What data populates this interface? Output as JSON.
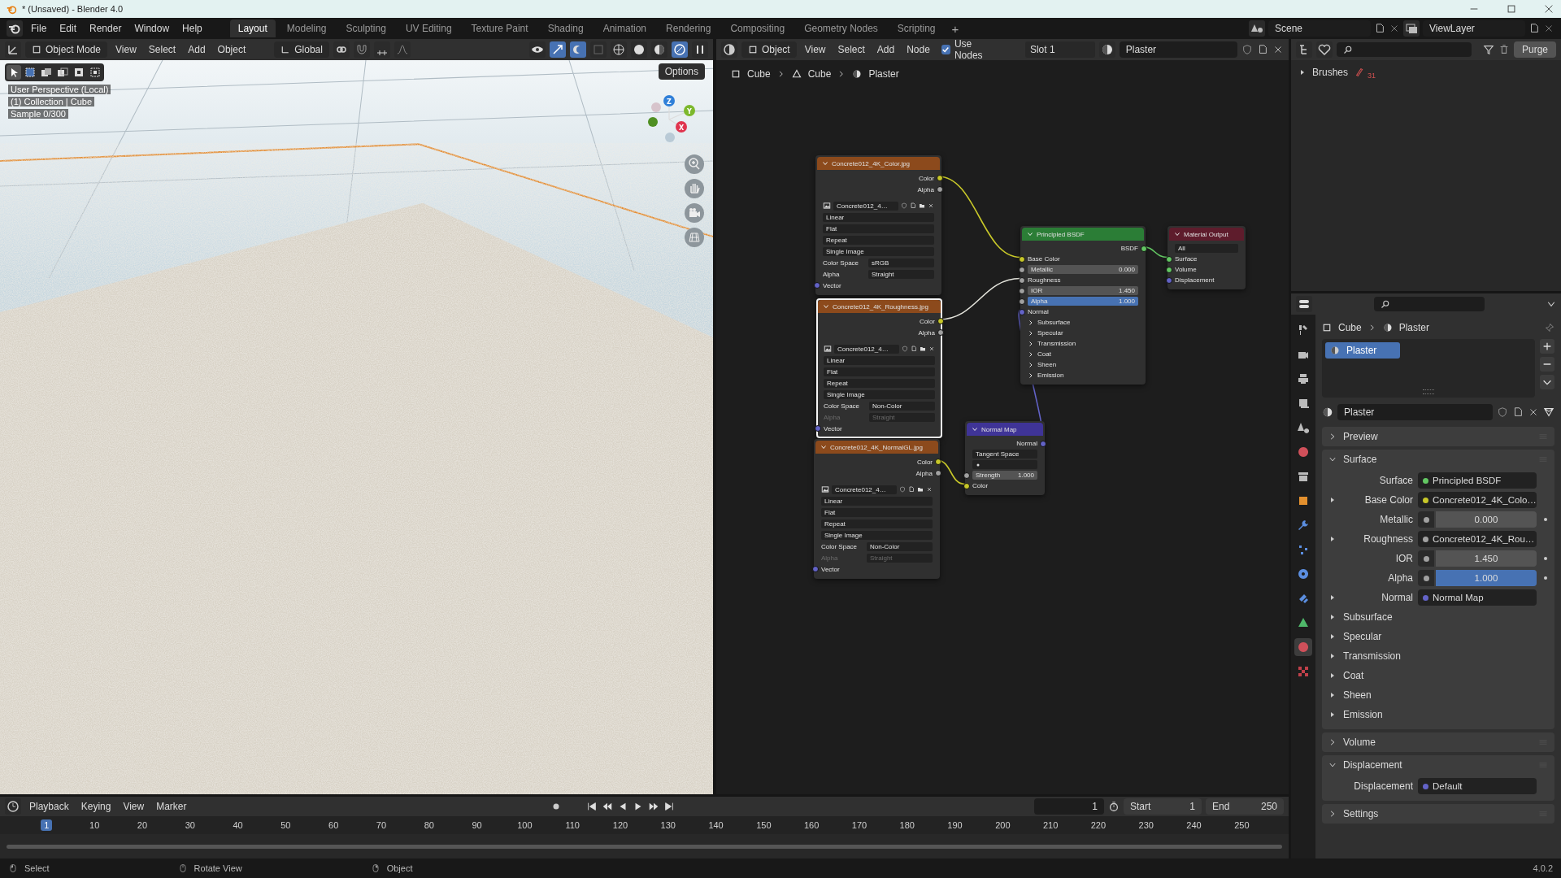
{
  "window": {
    "title": "* (Unsaved) - Blender 4.0"
  },
  "menu": [
    "File",
    "Edit",
    "Render",
    "Window",
    "Help"
  ],
  "workspaces": [
    {
      "label": "Layout",
      "selected": true
    },
    {
      "label": "Modeling",
      "selected": false
    },
    {
      "label": "Sculpting",
      "selected": false
    },
    {
      "label": "UV Editing",
      "selected": false
    },
    {
      "label": "Texture Paint",
      "selected": false
    },
    {
      "label": "Shading",
      "selected": false
    },
    {
      "label": "Animation",
      "selected": false
    },
    {
      "label": "Rendering",
      "selected": false
    },
    {
      "label": "Compositing",
      "selected": false
    },
    {
      "label": "Geometry Nodes",
      "selected": false
    },
    {
      "label": "Scripting",
      "selected": false
    }
  ],
  "add_workspace": "+",
  "scene": "Scene",
  "view_layer": "ViewLayer",
  "viewport": {
    "mode": "Object Mode",
    "menus": [
      "View",
      "Select",
      "Add",
      "Object"
    ],
    "orientation": "Global",
    "options": "Options",
    "overlay_text": [
      "User Perspective (Local)",
      "(1) Collection | Cube",
      "Sample 0/300"
    ],
    "axes": [
      "Z",
      "Y",
      "X"
    ]
  },
  "node_editor": {
    "object_type": "Object",
    "menus": [
      "View",
      "Select",
      "Add",
      "Node"
    ],
    "use_nodes": {
      "label": "Use Nodes",
      "checked": true
    },
    "slot": "Slot 1",
    "material": "Plaster",
    "breadcrumb": [
      "Cube",
      "Cube",
      "Plaster"
    ],
    "nodes": [
      {
        "kind": "image",
        "title": "Concrete012_4K_Color.jpg",
        "selected": false,
        "rows": [
          {
            "kind": "output",
            "label": "Color",
            "color": "#c7c729"
          },
          {
            "kind": "output",
            "label": "Alpha",
            "color": "#a1a1a1"
          },
          {
            "kind": "image",
            "value": "Concrete012_4…"
          },
          {
            "kind": "dropdown",
            "value": "Linear"
          },
          {
            "kind": "dropdown",
            "value": "Flat"
          },
          {
            "kind": "dropdown",
            "value": "Repeat"
          },
          {
            "kind": "dropdown",
            "value": "Single Image"
          },
          {
            "kind": "prop",
            "label": "Color Space",
            "value": "sRGB",
            "disabled": false
          },
          {
            "kind": "prop",
            "label": "Alpha",
            "value": "Straight",
            "disabled": false
          },
          {
            "kind": "input",
            "label": "Vector",
            "color": "#6363c7"
          }
        ]
      },
      {
        "kind": "image",
        "title": "Concrete012_4K_Roughness.jpg",
        "selected": true,
        "rows": [
          {
            "kind": "output",
            "label": "Color",
            "color": "#c7c729"
          },
          {
            "kind": "output",
            "label": "Alpha",
            "color": "#a1a1a1"
          },
          {
            "kind": "image",
            "value": "Concrete012_4…"
          },
          {
            "kind": "dropdown",
            "value": "Linear"
          },
          {
            "kind": "dropdown",
            "value": "Flat"
          },
          {
            "kind": "dropdown",
            "value": "Repeat"
          },
          {
            "kind": "dropdown",
            "value": "Single Image"
          },
          {
            "kind": "prop",
            "label": "Color Space",
            "value": "Non-Color",
            "disabled": false
          },
          {
            "kind": "prop",
            "label": "Alpha",
            "value": "Straight",
            "disabled": true
          },
          {
            "kind": "input",
            "label": "Vector",
            "color": "#6363c7"
          }
        ]
      },
      {
        "kind": "image",
        "title": "Concrete012_4K_NormalGL.jpg",
        "selected": false,
        "rows": [
          {
            "kind": "output",
            "label": "Color",
            "color": "#c7c729"
          },
          {
            "kind": "output",
            "label": "Alpha",
            "color": "#a1a1a1"
          },
          {
            "kind": "image",
            "value": "Concrete012_4…"
          },
          {
            "kind": "dropdown",
            "value": "Linear"
          },
          {
            "kind": "dropdown",
            "value": "Flat"
          },
          {
            "kind": "dropdown",
            "value": "Repeat"
          },
          {
            "kind": "dropdown",
            "value": "Single Image"
          },
          {
            "kind": "prop",
            "label": "Color Space",
            "value": "Non-Color",
            "disabled": false
          },
          {
            "kind": "prop",
            "label": "Alpha",
            "value": "Straight",
            "disabled": true
          },
          {
            "kind": "input",
            "label": "Vector",
            "color": "#6363c7"
          }
        ]
      },
      {
        "kind": "bsdf",
        "title": "Principled BSDF",
        "selected": false,
        "rows": [
          {
            "kind": "output",
            "label": "BSDF",
            "color": "#63c763"
          },
          {
            "kind": "input",
            "label": "Base Color",
            "color": "#c7c729"
          },
          {
            "kind": "slider",
            "label": "Metallic",
            "value": "0.000",
            "level": 0,
            "color": "#a1a1a1"
          },
          {
            "kind": "input",
            "label": "Roughness",
            "color": "#a1a1a1"
          },
          {
            "kind": "number",
            "label": "IOR",
            "value": "1.450",
            "color": "#a1a1a1"
          },
          {
            "kind": "slider",
            "label": "Alpha",
            "value": "1.000",
            "level": 1,
            "color": "#a1a1a1"
          },
          {
            "kind": "input",
            "label": "Normal",
            "color": "#6363c7"
          },
          {
            "kind": "panel",
            "label": "Subsurface"
          },
          {
            "kind": "panel",
            "label": "Specular"
          },
          {
            "kind": "panel",
            "label": "Transmission"
          },
          {
            "kind": "panel",
            "label": "Coat"
          },
          {
            "kind": "panel",
            "label": "Sheen"
          },
          {
            "kind": "panel",
            "label": "Emission"
          }
        ]
      },
      {
        "kind": "output",
        "title": "Material Output",
        "selected": false,
        "rows": [
          {
            "kind": "dropdown",
            "value": "All"
          },
          {
            "kind": "input",
            "label": "Surface",
            "color": "#63c763"
          },
          {
            "kind": "input",
            "label": "Volume",
            "color": "#63c763"
          },
          {
            "kind": "input",
            "label": "Displacement",
            "color": "#6363c7"
          }
        ]
      },
      {
        "kind": "normal_map",
        "title": "Normal Map",
        "selected": false,
        "rows": [
          {
            "kind": "output",
            "label": "Normal",
            "color": "#6363c7"
          },
          {
            "kind": "dropdown",
            "value": "Tangent Space"
          },
          {
            "kind": "field"
          },
          {
            "kind": "number",
            "label": "Strength",
            "value": "1.000",
            "color": "#a1a1a1"
          },
          {
            "kind": "input",
            "label": "Color",
            "color": "#c7c729"
          }
        ]
      }
    ]
  },
  "outliner": {
    "items": [
      {
        "label": "Brushes",
        "count": "31"
      }
    ],
    "purge": "Purge"
  },
  "properties": {
    "breadcrumb": [
      "Cube",
      "Plaster"
    ],
    "slots": [
      {
        "name": "Plaster",
        "selected": true
      }
    ],
    "material": "Plaster",
    "tabs": [
      {
        "kind": "tool",
        "selected": false
      },
      {
        "kind": "render",
        "selected": false
      },
      {
        "kind": "output",
        "selected": false
      },
      {
        "kind": "view_layer",
        "selected": false
      },
      {
        "kind": "scene",
        "selected": false
      },
      {
        "kind": "world",
        "selected": false
      },
      {
        "kind": "collection",
        "selected": false
      },
      {
        "kind": "object",
        "selected": false
      },
      {
        "kind": "modifiers",
        "selected": false
      },
      {
        "kind": "particles",
        "selected": false
      },
      {
        "kind": "physics",
        "selected": false
      },
      {
        "kind": "constraints",
        "selected": false
      },
      {
        "kind": "data",
        "selected": false
      },
      {
        "kind": "material",
        "selected": true
      },
      {
        "kind": "texture",
        "selected": false
      }
    ],
    "sections": [
      {
        "title": "Preview",
        "expanded": false
      },
      {
        "title": "Surface",
        "expanded": true,
        "rows": [
          {
            "kind": "link",
            "label": "Surface",
            "value": "Principled BSDF",
            "color": "#63c763",
            "expandable": false
          },
          {
            "kind": "link",
            "label": "Base Color",
            "value": "Concrete012_4K_Colo…",
            "color": "#c7c729",
            "expandable": true
          },
          {
            "kind": "number",
            "label": "Metallic",
            "value": "0.000"
          },
          {
            "kind": "link",
            "label": "Roughness",
            "value": "Concrete012_4K_Rou…",
            "color": "#a1a1a1",
            "expandable": true
          },
          {
            "kind": "number",
            "label": "IOR",
            "value": "1.450"
          },
          {
            "kind": "slider",
            "label": "Alpha",
            "value": "1.000",
            "level": 1
          },
          {
            "kind": "link",
            "label": "Normal",
            "value": "Normal Map",
            "color": "#6363c7",
            "expandable": true
          },
          {
            "kind": "panel",
            "label": "Subsurface"
          },
          {
            "kind": "panel",
            "label": "Specular"
          },
          {
            "kind": "panel",
            "label": "Transmission"
          },
          {
            "kind": "panel",
            "label": "Coat"
          },
          {
            "kind": "panel",
            "label": "Sheen"
          },
          {
            "kind": "panel",
            "label": "Emission"
          }
        ]
      },
      {
        "title": "Volume",
        "expanded": false
      },
      {
        "title": "Displacement",
        "expanded": true,
        "rows": [
          {
            "kind": "link",
            "label": "Displacement",
            "value": "Default",
            "color": "#6363c7",
            "expandable": false
          }
        ]
      },
      {
        "title": "Settings",
        "expanded": false
      }
    ]
  },
  "timeline": {
    "menus": [
      "Playback",
      "Keying",
      "View",
      "Marker"
    ],
    "current_frame": "1",
    "start_label": "Start",
    "start": "1",
    "end_label": "End",
    "end": "250",
    "ticks": [
      {
        "label": "1",
        "selected": true
      },
      {
        "label": "10",
        "selected": false
      },
      {
        "label": "20",
        "selected": false
      },
      {
        "label": "30",
        "selected": false
      },
      {
        "label": "40",
        "selected": false
      },
      {
        "label": "50",
        "selected": false
      },
      {
        "label": "60",
        "selected": false
      },
      {
        "label": "70",
        "selected": false
      },
      {
        "label": "80",
        "selected": false
      },
      {
        "label": "90",
        "selected": false
      },
      {
        "label": "100",
        "selected": false
      },
      {
        "label": "110",
        "selected": false
      },
      {
        "label": "120",
        "selected": false
      },
      {
        "label": "130",
        "selected": false
      },
      {
        "label": "140",
        "selected": false
      },
      {
        "label": "150",
        "selected": false
      },
      {
        "label": "160",
        "selected": false
      },
      {
        "label": "170",
        "selected": false
      },
      {
        "label": "180",
        "selected": false
      },
      {
        "label": "190",
        "selected": false
      },
      {
        "label": "200",
        "selected": false
      },
      {
        "label": "210",
        "selected": false
      },
      {
        "label": "220",
        "selected": false
      },
      {
        "label": "230",
        "selected": false
      },
      {
        "label": "240",
        "selected": false
      },
      {
        "label": "250",
        "selected": false
      }
    ]
  },
  "status_bar": {
    "items": [
      "Select",
      "Rotate View",
      "Object"
    ],
    "version": "4.0.2"
  }
}
